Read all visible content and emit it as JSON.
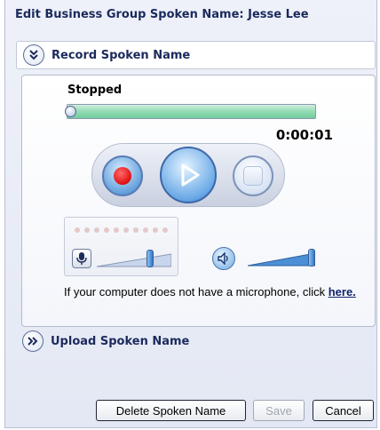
{
  "dialog": {
    "title": "Edit Business Group Spoken Name: Jesse Lee"
  },
  "record_section": {
    "label": "Record Spoken Name",
    "expander_icon": "chevron-double-down-icon",
    "status": "Stopped",
    "progress": 0.0,
    "elapsed_time": "0:00:01",
    "mic_level_dots": 10,
    "mic_volume": 0.72,
    "speaker_volume": 1.0,
    "hint_text": "If your computer does not have a microphone, click ",
    "hint_link": "here."
  },
  "upload_section": {
    "label": "Upload Spoken Name",
    "expander_icon": "chevron-double-right-icon"
  },
  "buttons": {
    "delete_label": "Delete Spoken Name",
    "save_label": "Save",
    "cancel_label": "Cancel"
  },
  "colors": {
    "accent": "#1b2a5c",
    "progress_green": "#72cc9c",
    "record_red": "#e01010",
    "button_blue": "#5e9cd9"
  }
}
